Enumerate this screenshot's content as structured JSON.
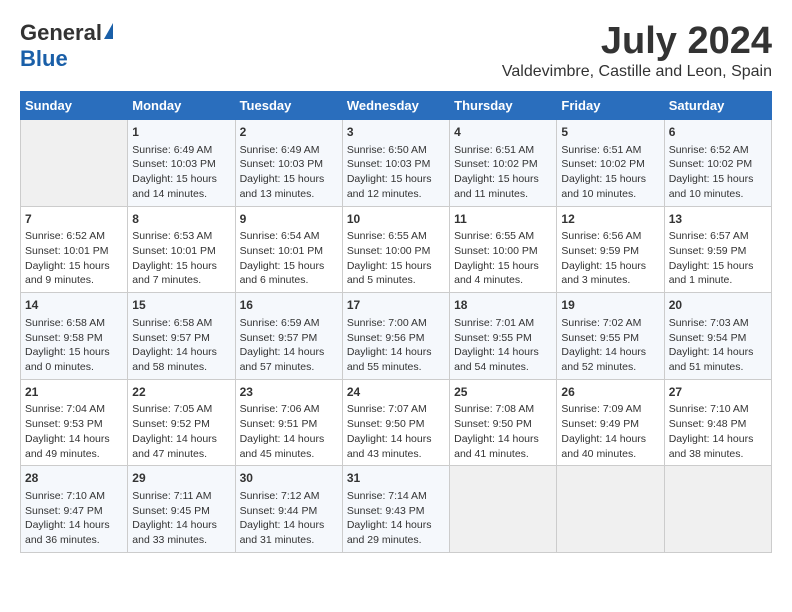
{
  "logo": {
    "general": "General",
    "blue": "Blue"
  },
  "title": {
    "month_year": "July 2024",
    "location": "Valdevimbre, Castille and Leon, Spain"
  },
  "days_of_week": [
    "Sunday",
    "Monday",
    "Tuesday",
    "Wednesday",
    "Thursday",
    "Friday",
    "Saturday"
  ],
  "weeks": [
    [
      {
        "day": "",
        "info": ""
      },
      {
        "day": "1",
        "info": "Sunrise: 6:49 AM\nSunset: 10:03 PM\nDaylight: 15 hours\nand 14 minutes."
      },
      {
        "day": "2",
        "info": "Sunrise: 6:49 AM\nSunset: 10:03 PM\nDaylight: 15 hours\nand 13 minutes."
      },
      {
        "day": "3",
        "info": "Sunrise: 6:50 AM\nSunset: 10:03 PM\nDaylight: 15 hours\nand 12 minutes."
      },
      {
        "day": "4",
        "info": "Sunrise: 6:51 AM\nSunset: 10:02 PM\nDaylight: 15 hours\nand 11 minutes."
      },
      {
        "day": "5",
        "info": "Sunrise: 6:51 AM\nSunset: 10:02 PM\nDaylight: 15 hours\nand 10 minutes."
      },
      {
        "day": "6",
        "info": "Sunrise: 6:52 AM\nSunset: 10:02 PM\nDaylight: 15 hours\nand 10 minutes."
      }
    ],
    [
      {
        "day": "7",
        "info": "Sunrise: 6:52 AM\nSunset: 10:01 PM\nDaylight: 15 hours\nand 9 minutes."
      },
      {
        "day": "8",
        "info": "Sunrise: 6:53 AM\nSunset: 10:01 PM\nDaylight: 15 hours\nand 7 minutes."
      },
      {
        "day": "9",
        "info": "Sunrise: 6:54 AM\nSunset: 10:01 PM\nDaylight: 15 hours\nand 6 minutes."
      },
      {
        "day": "10",
        "info": "Sunrise: 6:55 AM\nSunset: 10:00 PM\nDaylight: 15 hours\nand 5 minutes."
      },
      {
        "day": "11",
        "info": "Sunrise: 6:55 AM\nSunset: 10:00 PM\nDaylight: 15 hours\nand 4 minutes."
      },
      {
        "day": "12",
        "info": "Sunrise: 6:56 AM\nSunset: 9:59 PM\nDaylight: 15 hours\nand 3 minutes."
      },
      {
        "day": "13",
        "info": "Sunrise: 6:57 AM\nSunset: 9:59 PM\nDaylight: 15 hours\nand 1 minute."
      }
    ],
    [
      {
        "day": "14",
        "info": "Sunrise: 6:58 AM\nSunset: 9:58 PM\nDaylight: 15 hours\nand 0 minutes."
      },
      {
        "day": "15",
        "info": "Sunrise: 6:58 AM\nSunset: 9:57 PM\nDaylight: 14 hours\nand 58 minutes."
      },
      {
        "day": "16",
        "info": "Sunrise: 6:59 AM\nSunset: 9:57 PM\nDaylight: 14 hours\nand 57 minutes."
      },
      {
        "day": "17",
        "info": "Sunrise: 7:00 AM\nSunset: 9:56 PM\nDaylight: 14 hours\nand 55 minutes."
      },
      {
        "day": "18",
        "info": "Sunrise: 7:01 AM\nSunset: 9:55 PM\nDaylight: 14 hours\nand 54 minutes."
      },
      {
        "day": "19",
        "info": "Sunrise: 7:02 AM\nSunset: 9:55 PM\nDaylight: 14 hours\nand 52 minutes."
      },
      {
        "day": "20",
        "info": "Sunrise: 7:03 AM\nSunset: 9:54 PM\nDaylight: 14 hours\nand 51 minutes."
      }
    ],
    [
      {
        "day": "21",
        "info": "Sunrise: 7:04 AM\nSunset: 9:53 PM\nDaylight: 14 hours\nand 49 minutes."
      },
      {
        "day": "22",
        "info": "Sunrise: 7:05 AM\nSunset: 9:52 PM\nDaylight: 14 hours\nand 47 minutes."
      },
      {
        "day": "23",
        "info": "Sunrise: 7:06 AM\nSunset: 9:51 PM\nDaylight: 14 hours\nand 45 minutes."
      },
      {
        "day": "24",
        "info": "Sunrise: 7:07 AM\nSunset: 9:50 PM\nDaylight: 14 hours\nand 43 minutes."
      },
      {
        "day": "25",
        "info": "Sunrise: 7:08 AM\nSunset: 9:50 PM\nDaylight: 14 hours\nand 41 minutes."
      },
      {
        "day": "26",
        "info": "Sunrise: 7:09 AM\nSunset: 9:49 PM\nDaylight: 14 hours\nand 40 minutes."
      },
      {
        "day": "27",
        "info": "Sunrise: 7:10 AM\nSunset: 9:48 PM\nDaylight: 14 hours\nand 38 minutes."
      }
    ],
    [
      {
        "day": "28",
        "info": "Sunrise: 7:10 AM\nSunset: 9:47 PM\nDaylight: 14 hours\nand 36 minutes."
      },
      {
        "day": "29",
        "info": "Sunrise: 7:11 AM\nSunset: 9:45 PM\nDaylight: 14 hours\nand 33 minutes."
      },
      {
        "day": "30",
        "info": "Sunrise: 7:12 AM\nSunset: 9:44 PM\nDaylight: 14 hours\nand 31 minutes."
      },
      {
        "day": "31",
        "info": "Sunrise: 7:14 AM\nSunset: 9:43 PM\nDaylight: 14 hours\nand 29 minutes."
      },
      {
        "day": "",
        "info": ""
      },
      {
        "day": "",
        "info": ""
      },
      {
        "day": "",
        "info": ""
      }
    ]
  ]
}
